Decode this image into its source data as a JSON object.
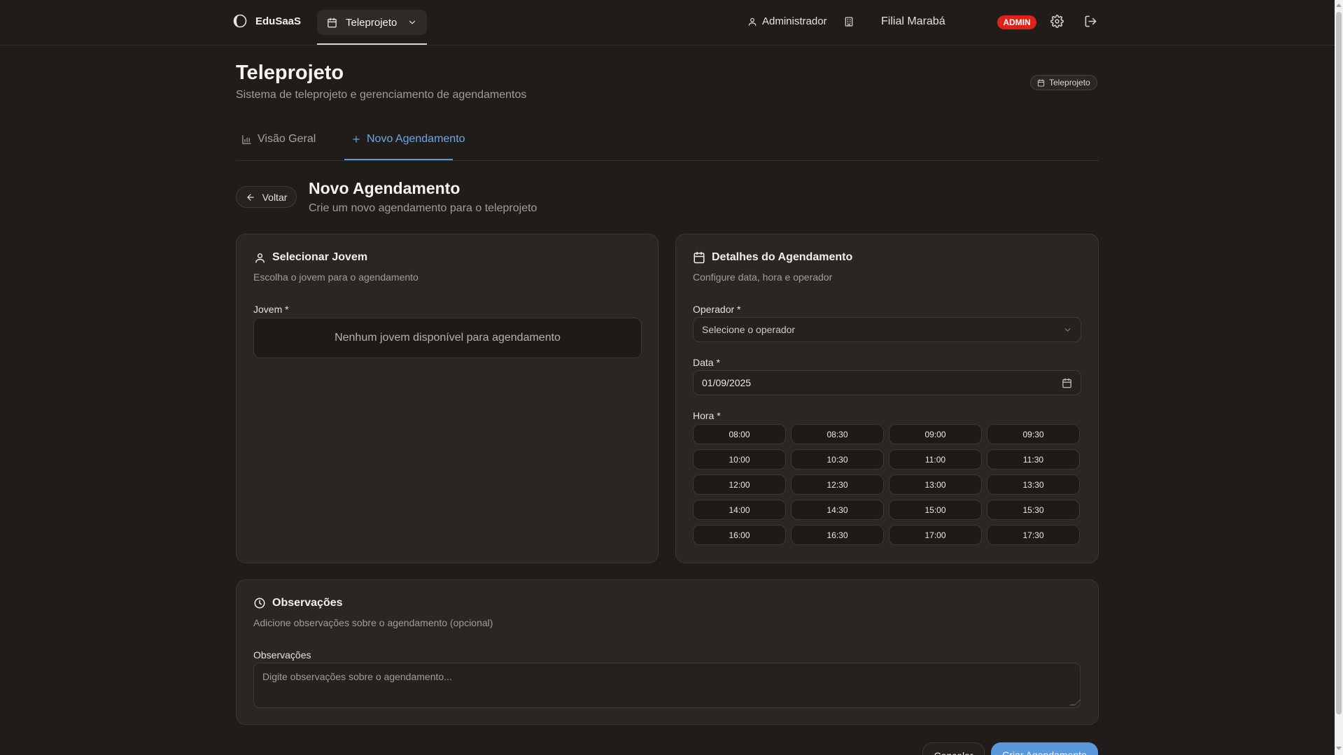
{
  "topbar": {
    "brand": "EduSaaS",
    "module": "Teleprojeto",
    "user": "Administrador",
    "branch": "Filial Marabá",
    "role_badge": "ADMIN"
  },
  "page": {
    "title": "Teleprojeto",
    "subtitle": "Sistema de teleprojeto e gerenciamento de agendamentos",
    "chip": "Teleprojeto"
  },
  "tabs": [
    {
      "label": "Visão Geral",
      "active": false
    },
    {
      "label": "Novo Agendamento",
      "active": true
    }
  ],
  "section": {
    "back_label": "Voltar",
    "title": "Novo Agendamento",
    "subtitle": "Crie um novo agendamento para o teleprojeto"
  },
  "select_youth": {
    "title": "Selecionar Jovem",
    "description": "Escolha o jovem para o agendamento",
    "field_label": "Jovem *",
    "empty_text": "Nenhum jovem disponível para agendamento"
  },
  "details": {
    "title": "Detalhes do Agendamento",
    "description": "Configure data, hora e operador",
    "operator_label": "Operador *",
    "operator_placeholder": "Selecione o operador",
    "date_label": "Data *",
    "date_value": "01/09/2025",
    "time_label": "Hora *",
    "times": [
      "08:00",
      "08:30",
      "09:00",
      "09:30",
      "10:00",
      "10:30",
      "11:00",
      "11:30",
      "12:00",
      "12:30",
      "13:00",
      "13:30",
      "14:00",
      "14:30",
      "15:00",
      "15:30",
      "16:00",
      "16:30",
      "17:00",
      "17:30"
    ]
  },
  "notes": {
    "title": "Observações",
    "description": "Adicione observações sobre o agendamento (opcional)",
    "field_label": "Observações",
    "placeholder": "Digite observações sobre o agendamento..."
  },
  "footer": {
    "cancel_label": "Cancelar",
    "create_label": "Criar Agendamento"
  },
  "colors": {
    "background": "#1f1c1a",
    "card": "#2a2623",
    "accent": "#5b97dc",
    "admin_badge": "#e0201b"
  }
}
